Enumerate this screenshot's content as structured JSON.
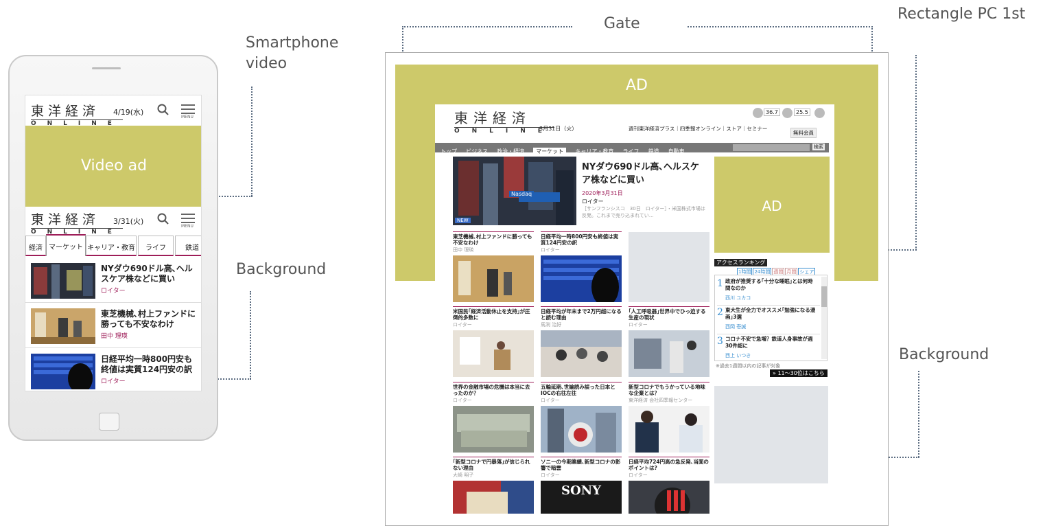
{
  "callouts": {
    "smartphone_video": "Smartphone\nvideo",
    "background_left": "Background",
    "gate": "Gate",
    "rectangle": "Rectangle PC 1st",
    "background_right": "Background"
  },
  "colors": {
    "ad_fill": "#cdc96a",
    "accent": "#9e1d58",
    "link": "#3a8fd0"
  },
  "mobile": {
    "logo": "東洋経済",
    "logo_sub": "ONLINE",
    "date_top": "4/19(水)",
    "menu": "MENU",
    "video_ad": "Video ad",
    "date_bottom": "3/31(火)",
    "tabs": [
      "経済",
      "マーケット",
      "キャリア・教育",
      "ライフ",
      "鉄道"
    ],
    "articles": [
      {
        "title": "NYダウ690ドル高､ヘルスケア株などに買い",
        "author": "ロイター"
      },
      {
        "title": "東芝機械､村上ファンドに勝っても不安なわけ",
        "author": "田中 理瑛"
      },
      {
        "title": "日経平均一時800円安も終値は実質124円安の訳",
        "author": "ロイター"
      }
    ]
  },
  "desktop": {
    "gate_ad": "AD",
    "rect_ad": "AD",
    "logo": "東洋経済",
    "logo_sub": "ONLINE",
    "date": "3月31日（火）",
    "twitter_count": "36.7",
    "facebook_count": "25.5",
    "links": "週刊東洋経済プラス｜四季報オンライン｜ストア｜セミナー",
    "member": "無料会員",
    "nav": [
      "トップ",
      "ビジネス",
      "政治・経済",
      "マーケット",
      "キャリア・教育",
      "ライフ",
      "鉄道",
      "自動車"
    ],
    "search_btn": "検索",
    "hero": {
      "title": "NYダウ690ドル高､ヘルスケア株などに買い",
      "date": "2020年3月31日",
      "source": "ロイター",
      "summary": "［サンフランシスコ　30日　ロイター］・米国株式市場は反発。これまで売り込まれてい…",
      "badge": "NEW",
      "img_label": "Nasdaq"
    },
    "articles": [
      {
        "title": "東芝機械､村上ファンドに勝っても不安なわけ",
        "author": "田中 理瑛"
      },
      {
        "title": "日経平均一時800円安も終値は実質124円安の訳",
        "author": "ロイター"
      },
      {
        "title": "米国民｢経済活動休止を支持｣が圧倒的多数に",
        "author": "ロイター"
      },
      {
        "title": "日経平均が年末まで2万円超になると読む理由",
        "author": "馬渕 治好"
      },
      {
        "title": "｢人工呼吸器｣世界中でひっ迫する生産の現状",
        "author": "ロイター"
      },
      {
        "title": "世界の金融市場の危機は本当に去ったのか？",
        "author": "ロイター"
      },
      {
        "title": "五輪延期､世論読み誤った日本とIOCの右往左往",
        "author": "ロイター"
      },
      {
        "title": "新型コロナでもうかっている地味な企業とは？",
        "author": "東洋経済 会社四季報センター"
      },
      {
        "title": "｢新型コロナで円暴落｣が信じられない理由",
        "author": "大崎 明子"
      },
      {
        "title": "ソニーの今期業績､新型コロナの影響で暗雲",
        "author": "ロイター"
      },
      {
        "title": "日経平均724円高の急反発､当面のポイントは?",
        "author": "ロイター"
      }
    ],
    "sony": "SONY",
    "ranking": {
      "title": "アクセスランキング",
      "tabs": [
        "1時間",
        "24時間",
        "週間",
        "月間",
        "シェア"
      ],
      "items": [
        {
          "num": "1",
          "title": "政府が推奨する｢十分な睡眠｣とは何時間なのか",
          "author": "西川 ユカコ"
        },
        {
          "num": "2",
          "title": "東大生が全力でオススメ｢勉強になる漫画｣3選",
          "author": "西岡 壱誠"
        },
        {
          "num": "3",
          "title": "コロナ不安で急増？鉄道人身事故が週30件超に",
          "author": "西上 いつき"
        }
      ],
      "note": "※過去1週間以内の記事が対象",
      "more": "» 11〜30位はこちら"
    }
  }
}
